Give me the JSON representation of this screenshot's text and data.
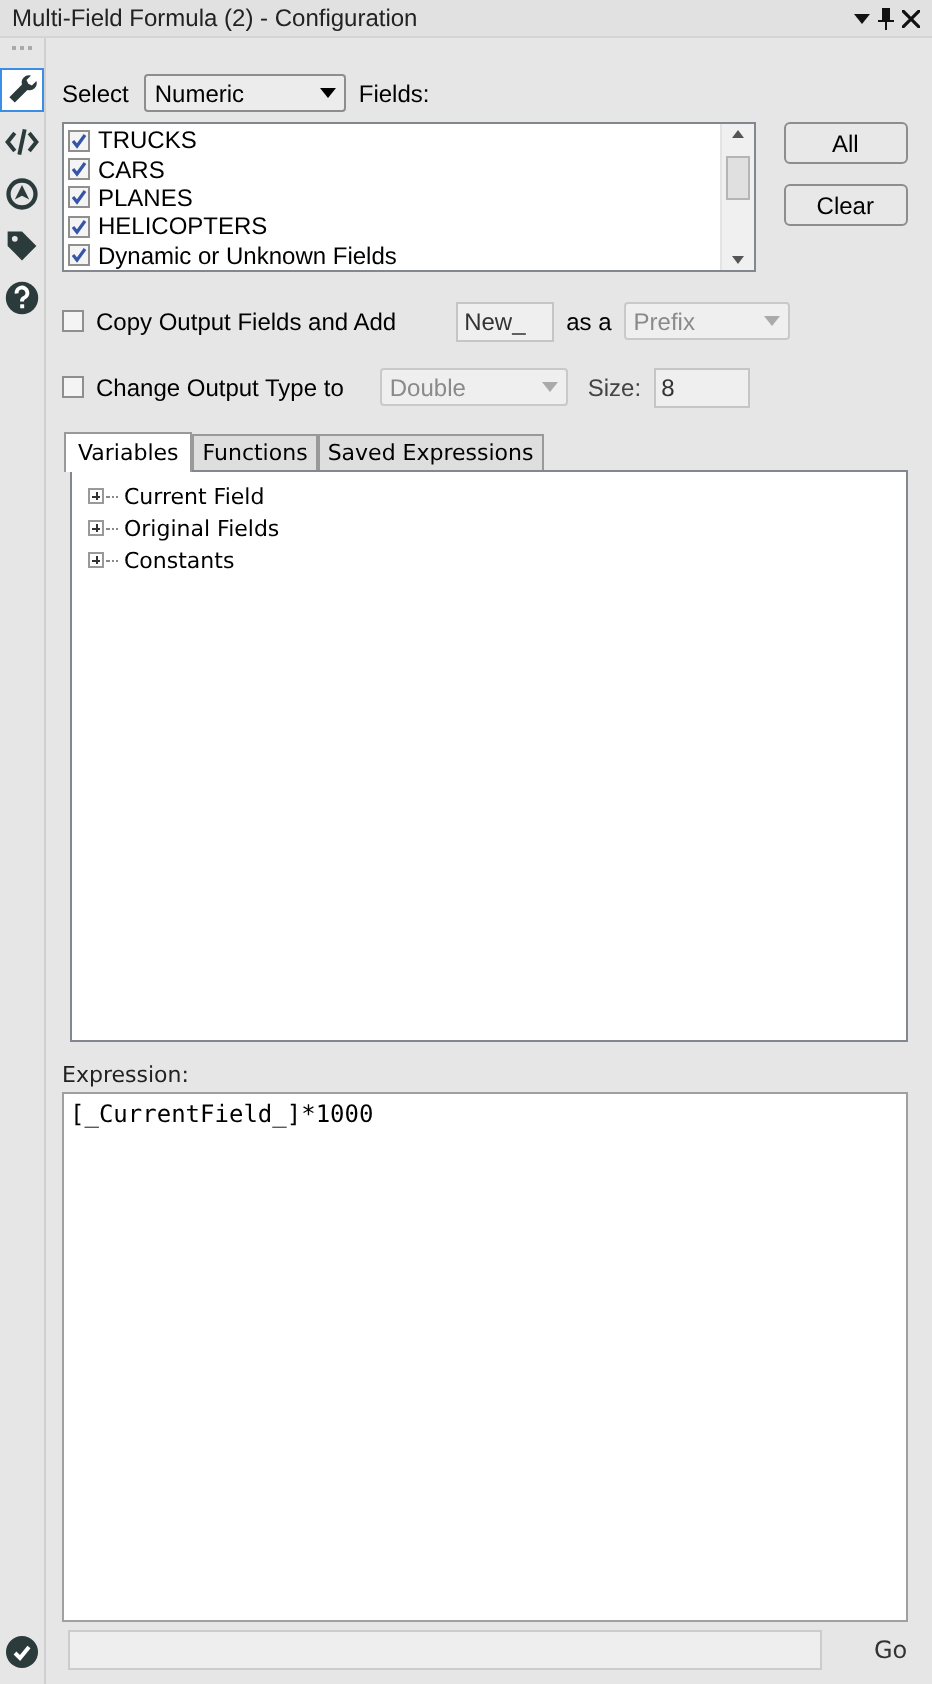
{
  "window": {
    "title": "Multi-Field Formula (2) - Configuration"
  },
  "sidebar": {
    "items": [
      {
        "kind": "wrench",
        "selected": true
      },
      {
        "kind": "code",
        "selected": false
      },
      {
        "kind": "compass",
        "selected": false
      },
      {
        "kind": "tag",
        "selected": false
      },
      {
        "kind": "help",
        "selected": false
      }
    ]
  },
  "select": {
    "label": "Select",
    "value": "Numeric",
    "fields_label": "Fields:"
  },
  "fields": [
    {
      "name": "TRUCKS",
      "checked": true
    },
    {
      "name": "CARS",
      "checked": true
    },
    {
      "name": "PLANES",
      "checked": true
    },
    {
      "name": "HELICOPTERS",
      "checked": true
    },
    {
      "name": "Dynamic or Unknown Fields",
      "checked": true
    }
  ],
  "buttons": [
    "All",
    "Clear"
  ],
  "copy_output": {
    "label": "Copy Output Fields and Add",
    "checked": false,
    "value": "New_",
    "disabled": true,
    "as_label": "as a",
    "position": "Prefix"
  },
  "change_type": {
    "label": "Change Output Type to",
    "checked": false,
    "type": "Double",
    "disabled": true,
    "size_label": "Size:",
    "size": "8"
  },
  "tabs": [
    {
      "label": "Variables",
      "selected": true
    },
    {
      "label": "Functions",
      "selected": false
    },
    {
      "label": "Saved Expressions",
      "selected": false
    }
  ],
  "tree": [
    {
      "label": "Current Field",
      "expanded": false
    },
    {
      "label": "Original Fields",
      "expanded": false
    },
    {
      "label": "Constants",
      "expanded": false
    }
  ],
  "expression": {
    "label": "Expression:",
    "value": "[_CurrentField_]*1000"
  },
  "footer": {
    "go": "Go"
  }
}
